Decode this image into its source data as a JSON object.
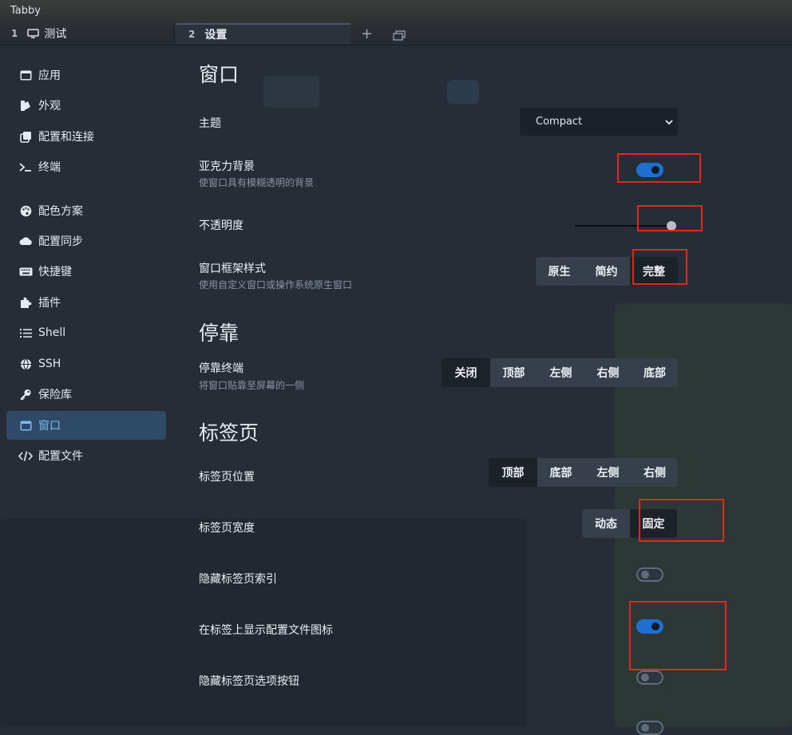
{
  "app": {
    "title": "Tabby"
  },
  "tabs": [
    {
      "number": "1",
      "label": "测试",
      "icon": "monitor-icon"
    },
    {
      "number": "2",
      "label": "设置"
    }
  ],
  "tab_controls": {
    "add": "+"
  },
  "sidebar": {
    "items": [
      {
        "label": "应用",
        "icon": "window-icon"
      },
      {
        "label": "外观",
        "icon": "swatches-icon"
      },
      {
        "label": "配置和连接",
        "icon": "copy-icon"
      },
      {
        "label": "终端",
        "icon": "terminal-icon"
      },
      {
        "label": "配色方案",
        "icon": "palette-icon"
      },
      {
        "label": "配置同步",
        "icon": "cloud-icon"
      },
      {
        "label": "快捷键",
        "icon": "keyboard-icon"
      },
      {
        "label": "插件",
        "icon": "puzzle-icon"
      },
      {
        "label": "Shell",
        "icon": "list-icon"
      },
      {
        "label": "SSH",
        "icon": "globe-icon"
      },
      {
        "label": "保险库",
        "icon": "key-icon"
      },
      {
        "label": "窗口",
        "icon": "window-icon",
        "active": true
      },
      {
        "label": "配置文件",
        "icon": "code-icon"
      }
    ]
  },
  "window_section": {
    "title": "窗口",
    "theme": {
      "label": "主题",
      "value": "Compact"
    },
    "acrylic": {
      "label": "亚克力背景",
      "desc": "使窗口具有模糊透明的背景",
      "on": true
    },
    "opacity": {
      "label": "不透明度",
      "value": 1.0
    },
    "frame": {
      "label": "窗口框架样式",
      "desc": "使用自定义窗口或操作系统原生窗口",
      "options": [
        "原生",
        "简约",
        "完整"
      ],
      "selected": "完整"
    }
  },
  "dock_section": {
    "title": "停靠",
    "dock": {
      "label": "停靠终端",
      "desc": "将窗口贴靠至屏幕的一侧",
      "options": [
        "关闭",
        "顶部",
        "左侧",
        "右侧",
        "底部"
      ],
      "selected": "关闭"
    }
  },
  "tabs_section": {
    "title": "标签页",
    "position": {
      "label": "标签页位置",
      "options": [
        "顶部",
        "底部",
        "左侧",
        "右侧"
      ],
      "selected": "顶部"
    },
    "width": {
      "label": "标签页宽度",
      "options": [
        "动态",
        "固定"
      ],
      "selected": "固定"
    },
    "hide_index": {
      "label": "隐藏标签页索引",
      "on": false
    },
    "show_icon": {
      "label": "在标签上显示配置文件图标",
      "on": true
    },
    "hide_options": {
      "label": "隐藏标签页选项按钮",
      "on": false
    }
  },
  "colors": {
    "accent": "#1e6fd1",
    "highlight": "#e0281e",
    "active_nav": "#2e4a66"
  }
}
